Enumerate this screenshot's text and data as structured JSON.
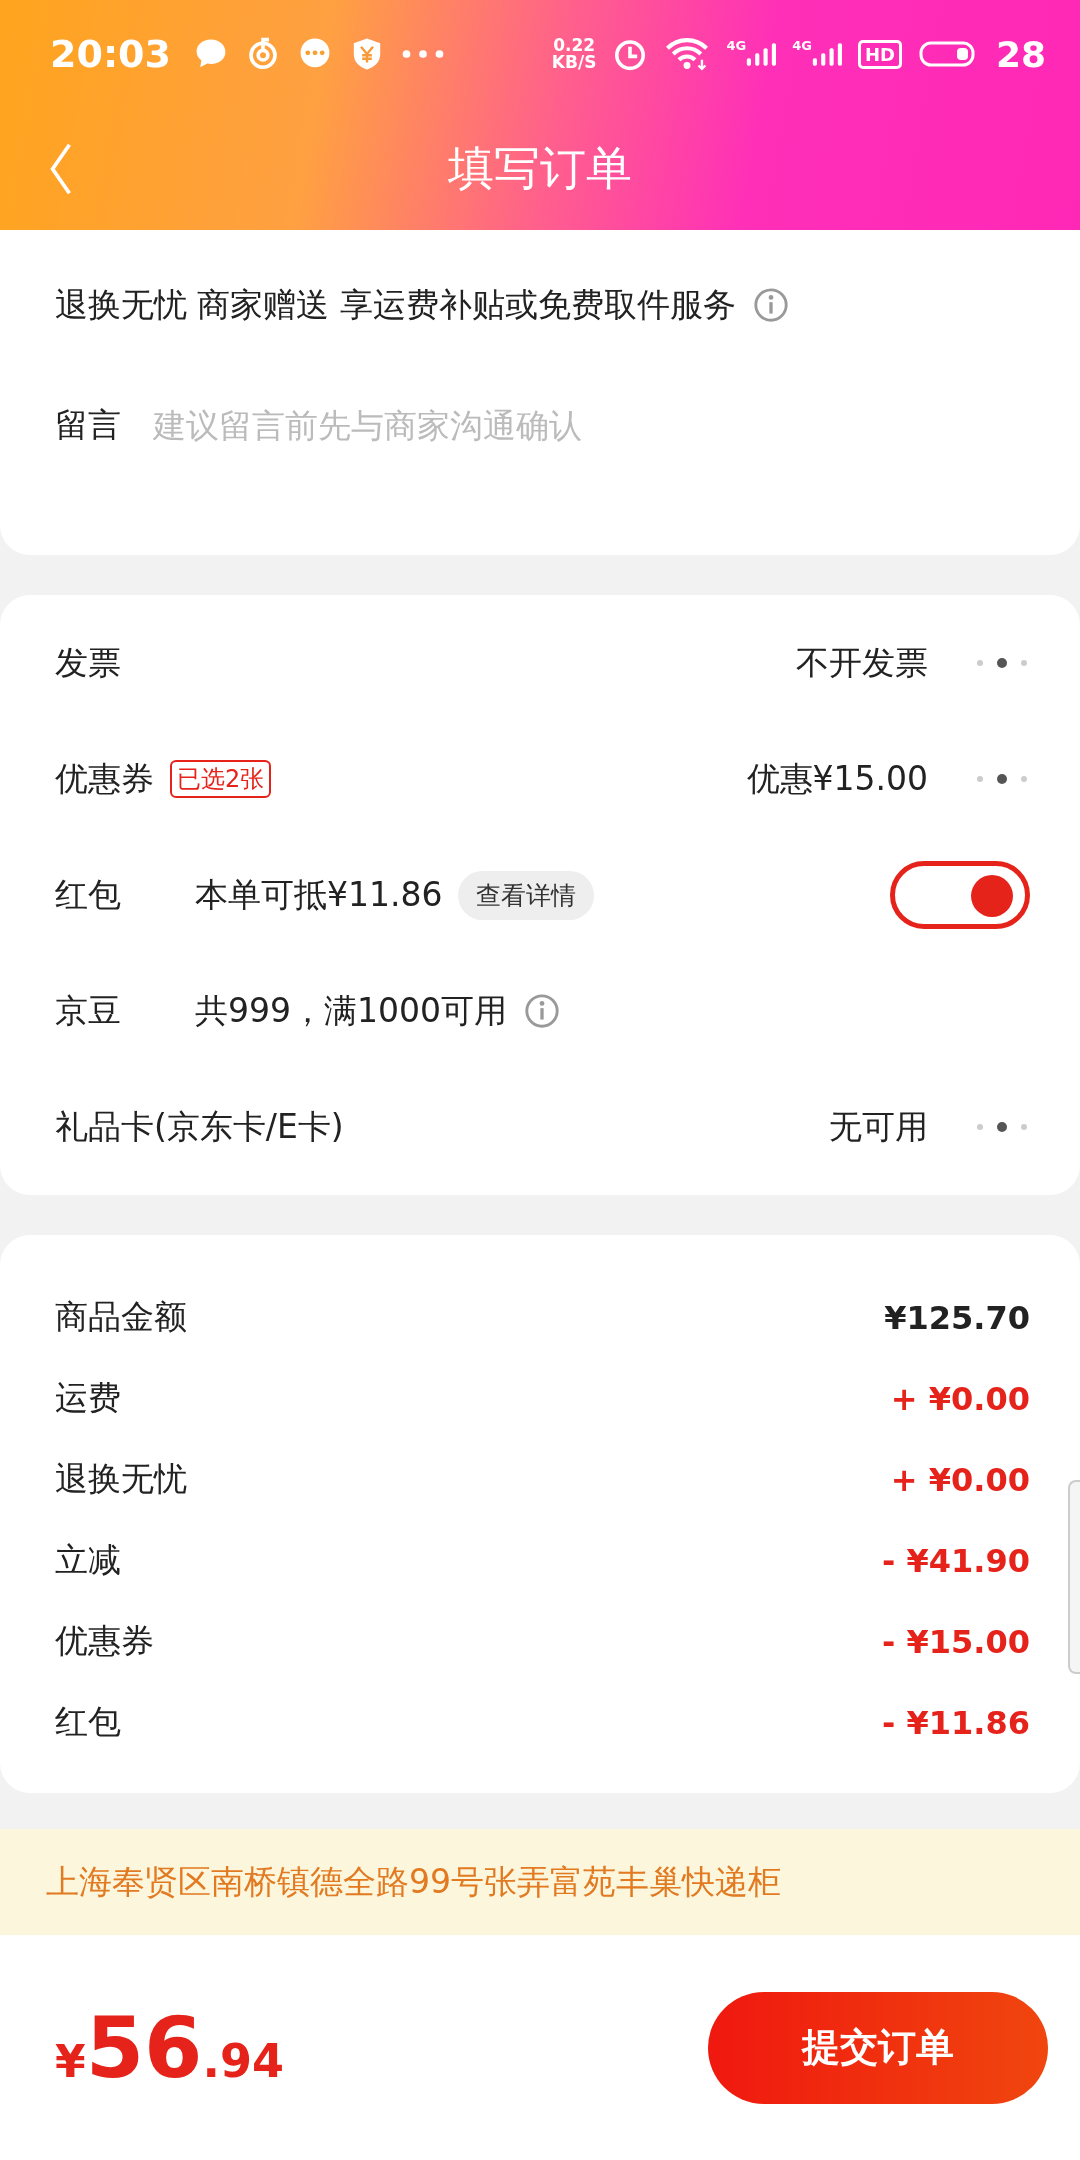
{
  "status_bar": {
    "time": "20:03",
    "speed": "0.22",
    "speed_unit": "KB/S",
    "net_1": "4G",
    "net_2": "4G",
    "hd": "HD",
    "battery": "28"
  },
  "header": {
    "title": "填写订单"
  },
  "service_card": {
    "items": [
      {
        "kind": "service",
        "text": "退换无忧 商家赠送 享运费补贴或免费取件服务"
      },
      {
        "kind": "message",
        "label": "留言",
        "placeholder": "建议留言前先与商家沟通确认"
      }
    ]
  },
  "options_card": {
    "items": [
      {
        "kind": "link",
        "label": "发票",
        "value": "不开发票"
      },
      {
        "kind": "link",
        "label": "优惠券",
        "badge": "已选2张",
        "value": "优惠¥15.00"
      },
      {
        "kind": "toggle",
        "label": "红包",
        "note": "本单可抵¥11.86",
        "button": "查看详情",
        "on": true
      },
      {
        "kind": "info",
        "label": "京豆",
        "note": "共999，满1000可用"
      },
      {
        "kind": "link",
        "label": "礼品卡(京东卡/E卡)",
        "value": "无可用"
      }
    ]
  },
  "summary": {
    "rows": [
      {
        "label": "商品金额",
        "value": "¥125.70",
        "kind": "base"
      },
      {
        "label": "运费",
        "value": "+ ¥0.00",
        "kind": "adjust"
      },
      {
        "label": "退换无忧",
        "value": "+ ¥0.00",
        "kind": "adjust"
      },
      {
        "label": "立减",
        "value": "- ¥41.90",
        "kind": "adjust"
      },
      {
        "label": "优惠券",
        "value": "- ¥15.00",
        "kind": "adjust"
      },
      {
        "label": "红包",
        "value": "- ¥11.86",
        "kind": "adjust"
      }
    ]
  },
  "address": "上海奉贤区南桥镇德全路99号张弄富苑丰巢快递柜",
  "footer": {
    "currency": "¥",
    "price_int": "56",
    "price_dec": ".94",
    "submit": "提交订单"
  }
}
